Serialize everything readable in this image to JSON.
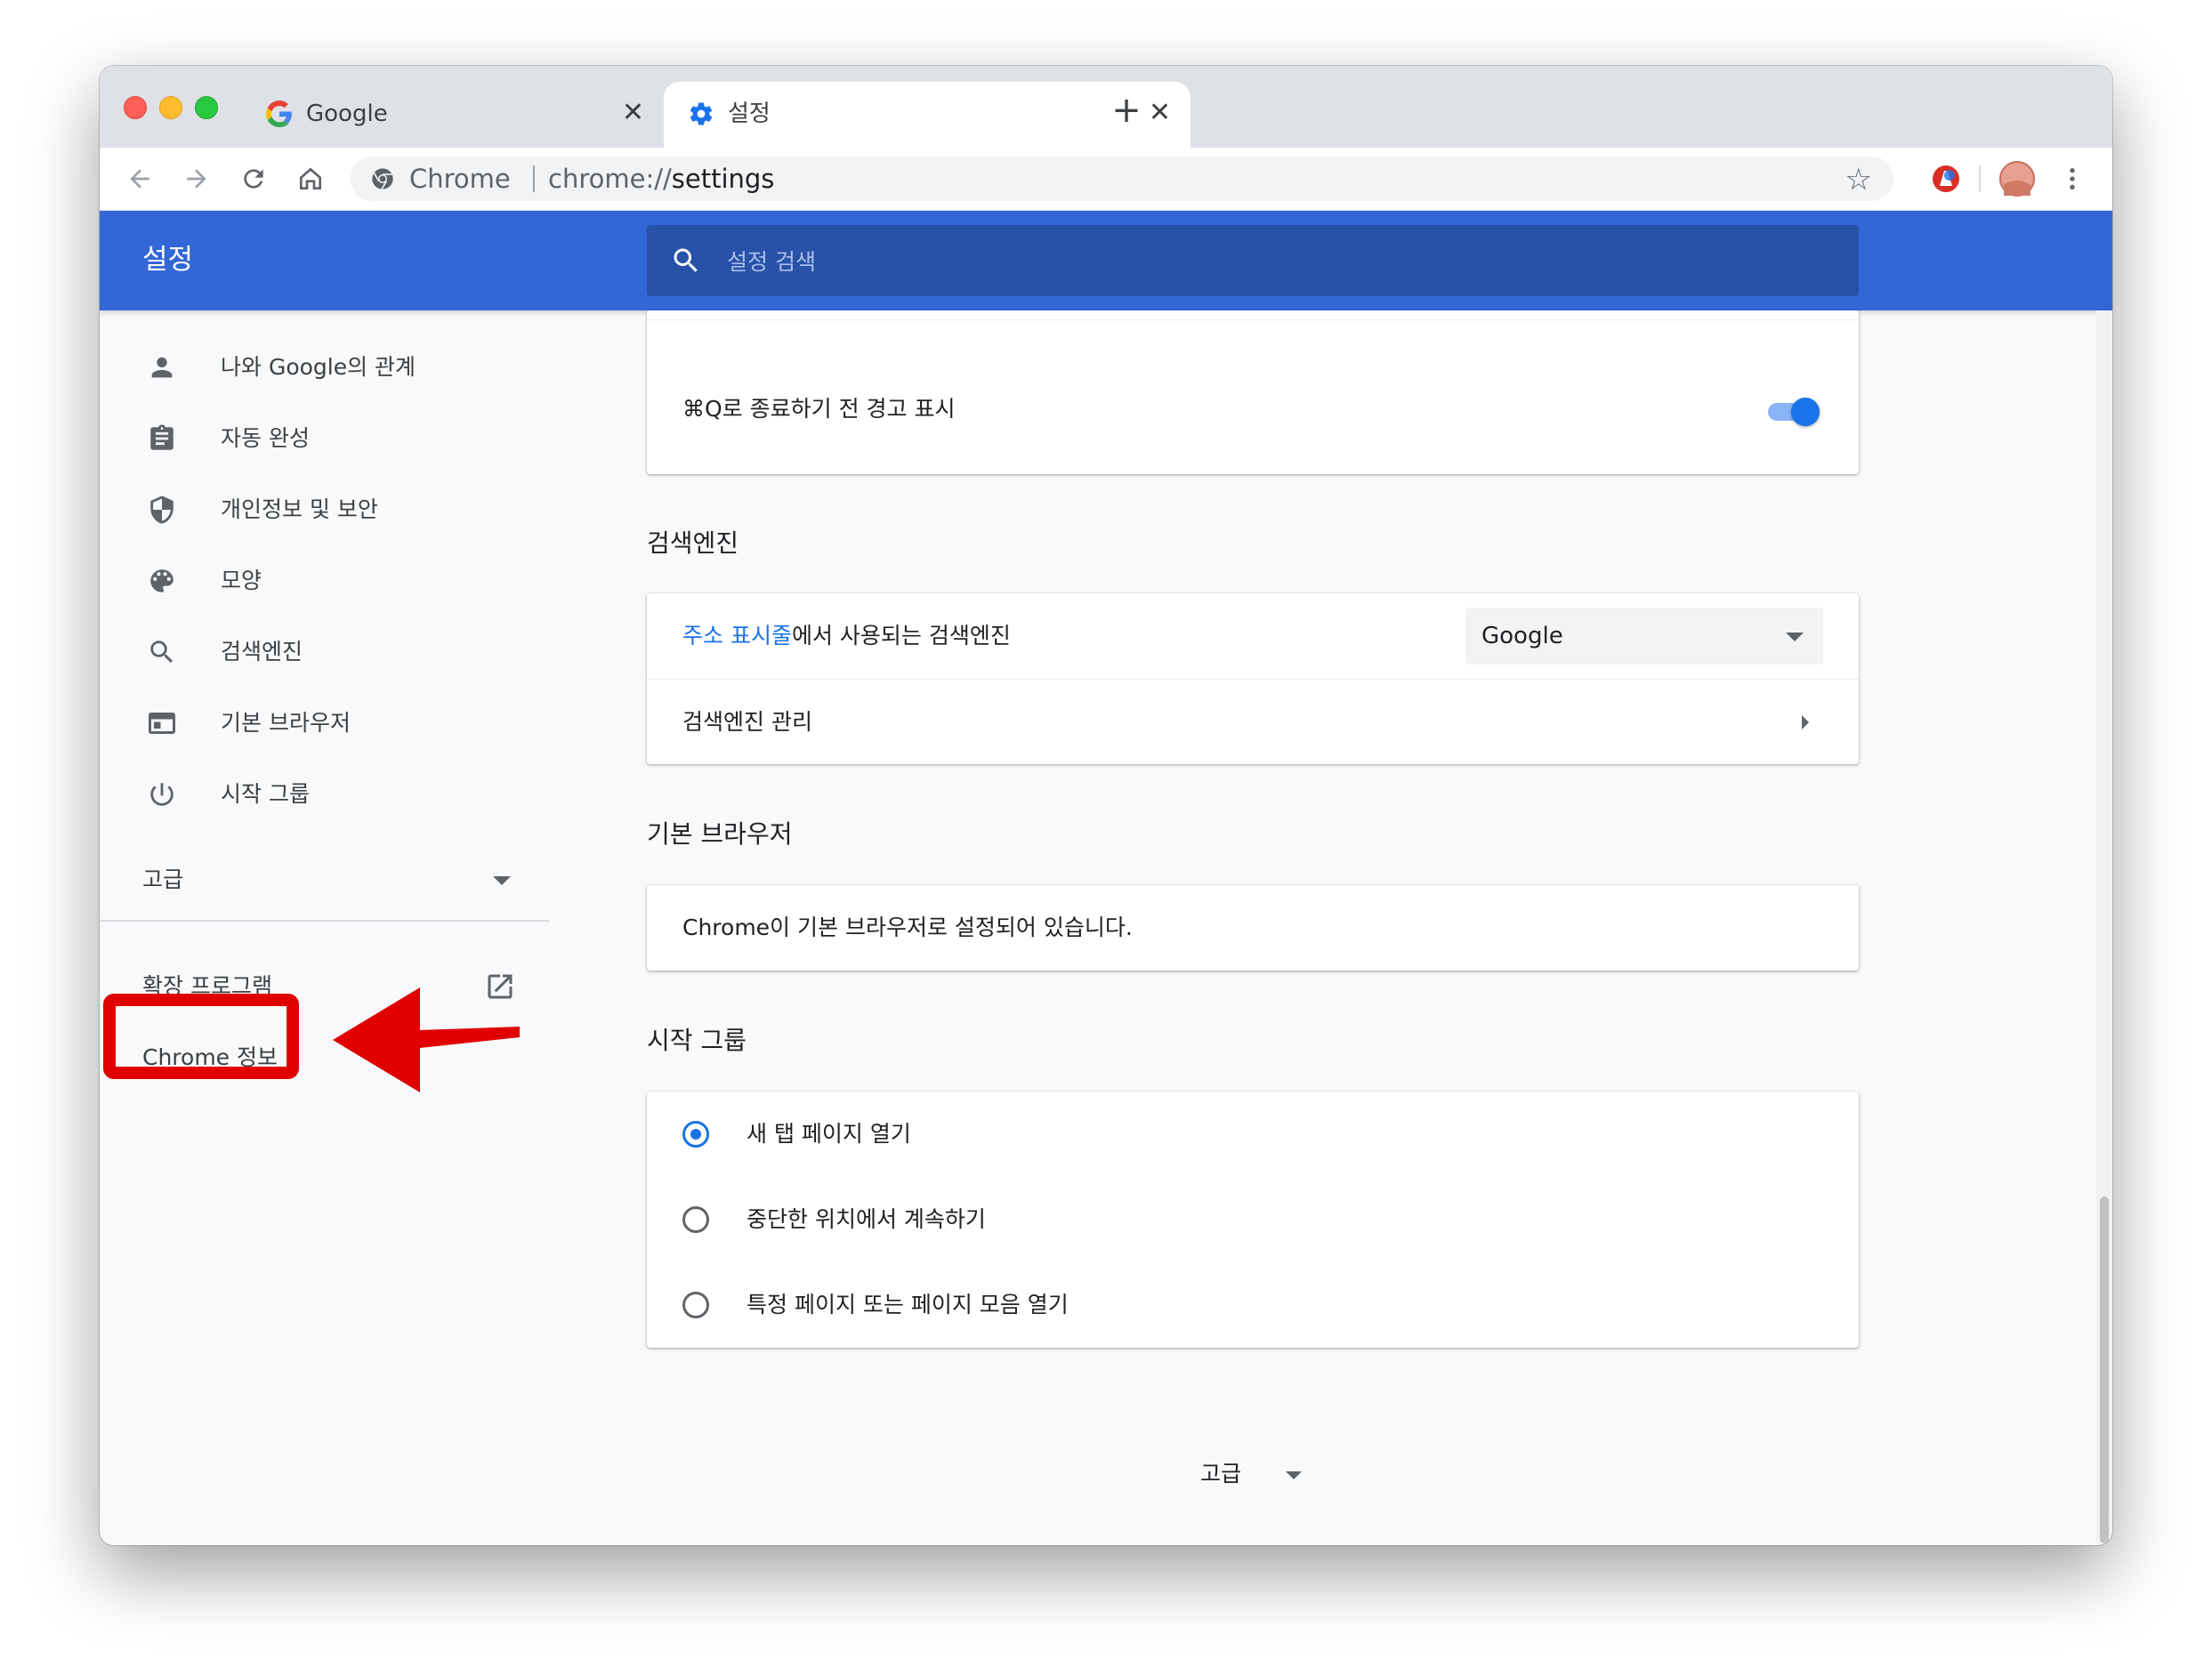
{
  "tabs": [
    {
      "title": "Google",
      "icon": "google-g-icon",
      "close": "✕",
      "active": false
    },
    {
      "title": "설정",
      "icon": "gear-icon",
      "close": "✕",
      "active": true
    }
  ],
  "new_tab_label": "+",
  "omnibox": {
    "chrome_label": "Chrome",
    "url_prefix": "chrome://",
    "url_path": "settings"
  },
  "header": {
    "title": "설정",
    "search_placeholder": "설정 검색"
  },
  "sidebar": {
    "items": [
      {
        "label": "나와 Google의 관계",
        "icon": "person-icon"
      },
      {
        "label": "자동 완성",
        "icon": "clipboard-icon"
      },
      {
        "label": "개인정보 및 보안",
        "icon": "shield-icon"
      },
      {
        "label": "모양",
        "icon": "palette-icon"
      },
      {
        "label": "검색엔진",
        "icon": "search-icon"
      },
      {
        "label": "기본 브라우저",
        "icon": "browser-window-icon"
      },
      {
        "label": "시작 그룹",
        "icon": "power-icon"
      }
    ],
    "advanced_label": "고급",
    "extensions_label": "확장 프로그램",
    "about_label": "Chrome 정보"
  },
  "main": {
    "warn_quit_label": "⌘Q로 종료하기 전 경고 표시",
    "warn_quit_enabled": true,
    "search_engine_section": "검색엔진",
    "address_bar_link": "주소 표시줄",
    "address_bar_suffix": "에서 사용되는 검색엔진",
    "search_engine_value": "Google",
    "manage_engines_label": "검색엔진 관리",
    "default_browser_section": "기본 브라우저",
    "default_browser_status": "Chrome이 기본 브라우저로 설정되어 있습니다.",
    "startup_section": "시작 그룹",
    "startup_options": [
      {
        "label": "새 탭 페이지 열기",
        "checked": true
      },
      {
        "label": "중단한 위치에서 계속하기",
        "checked": false
      },
      {
        "label": "특정 페이지 또는 페이지 모음 열기",
        "checked": false
      }
    ],
    "advanced_label": "고급"
  },
  "colors": {
    "header": "#3367d6",
    "search_bg": "#2851a8",
    "accent": "#1a73e8",
    "annotation": "#e00000"
  }
}
